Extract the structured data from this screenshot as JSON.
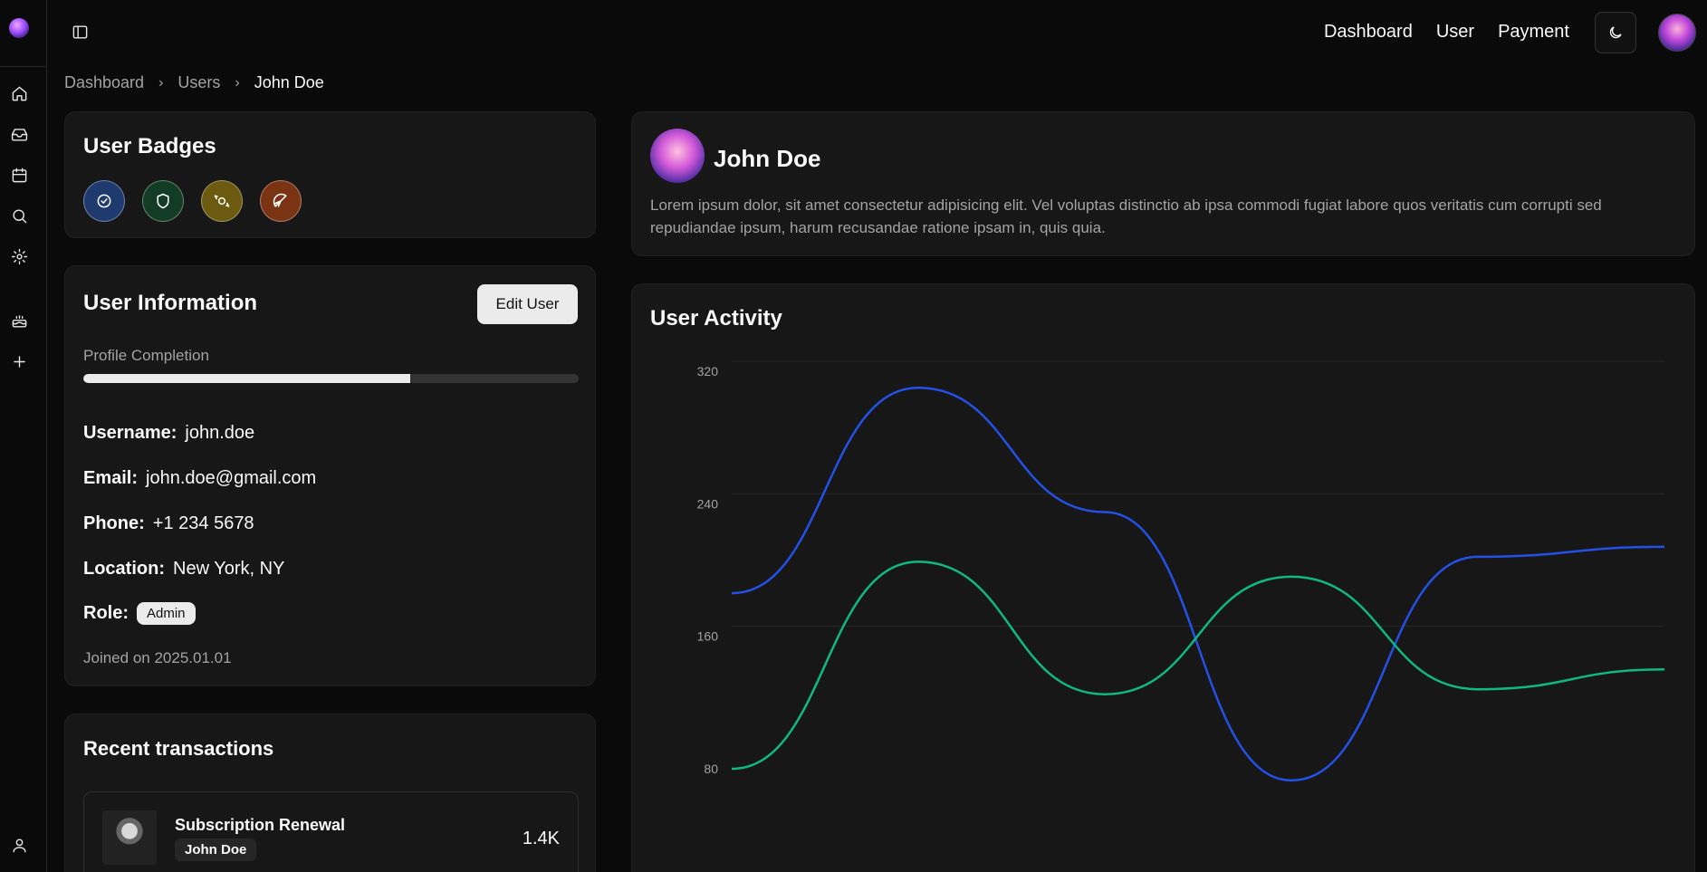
{
  "header": {
    "nav": [
      "Dashboard",
      "User",
      "Payment"
    ]
  },
  "breadcrumb": {
    "items": [
      "Dashboard",
      "Users"
    ],
    "current": "John Doe"
  },
  "badges": {
    "title": "User Badges",
    "items": [
      {
        "icon": "badge-check-icon",
        "color": "#1e3a6e"
      },
      {
        "icon": "shield-icon",
        "color": "#123d24"
      },
      {
        "icon": "candy-icon",
        "color": "#6b5a0f"
      },
      {
        "icon": "citrus-icon",
        "color": "#7a3414"
      }
    ]
  },
  "info": {
    "title": "User Information",
    "edit_label": "Edit User",
    "completion_label": "Profile Completion",
    "completion": 0.66,
    "username_label": "Username:",
    "username": "john.doe",
    "email_label": "Email:",
    "email": "john.doe@gmail.com",
    "phone_label": "Phone:",
    "phone": "+1 234 5678",
    "location_label": "Location:",
    "location": "New York, NY",
    "role_label": "Role:",
    "role": "Admin",
    "joined": "Joined on 2025.01.01"
  },
  "transactions": {
    "title": "Recent transactions",
    "items": [
      {
        "title": "Subscription Renewal",
        "user": "John Doe",
        "amount": "1.4K"
      }
    ]
  },
  "profile": {
    "name": "John Doe",
    "bio": "Lorem ipsum dolor, sit amet consectetur adipisicing elit. Vel voluptas distinctio ab ipsa commodi fugiat labore quos veritatis cum corrupti sed repudiandae ipsum, harum recusandae ratione ipsam in, quis quia."
  },
  "activity": {
    "title": "User Activity"
  },
  "chart_data": {
    "type": "line",
    "title": "User Activity",
    "ylim": [
      80,
      320
    ],
    "yticks": [
      320,
      240,
      160,
      80
    ],
    "grid": true,
    "series": [
      {
        "color": "#2350e6",
        "values": [
          186,
          310,
          235,
          73,
          208,
          214
        ]
      },
      {
        "color": "#10b981",
        "values": [
          80,
          205,
          125,
          196,
          128,
          140
        ]
      }
    ]
  },
  "colors": {
    "accent": "#2350e6",
    "secondary": "#10b981"
  }
}
